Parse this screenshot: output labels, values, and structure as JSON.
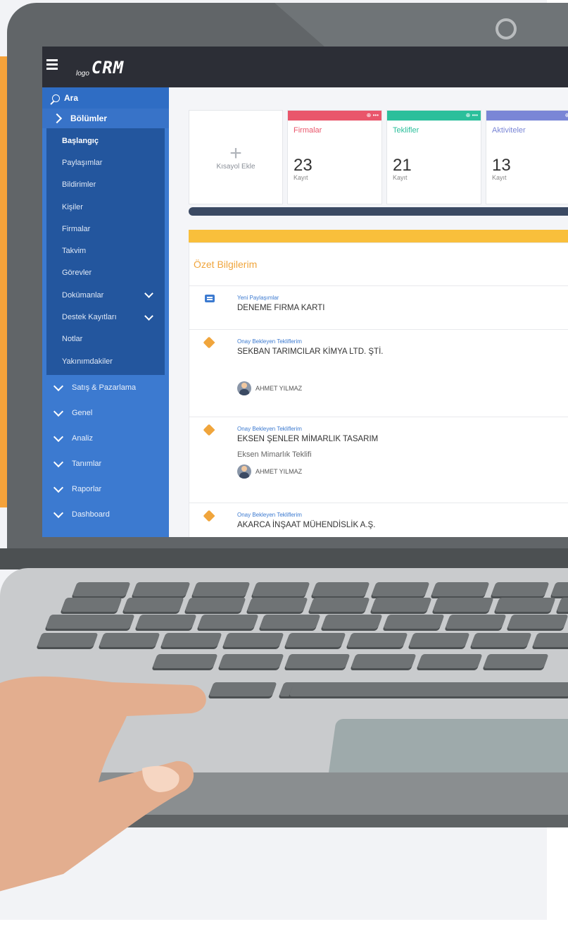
{
  "app": {
    "logo_small": "logo",
    "logo_big": "CRM"
  },
  "sidebar": {
    "search_label": "Ara",
    "section_label": "Bölümler",
    "items": [
      {
        "label": "Başlangıç",
        "active": true,
        "expandable": false
      },
      {
        "label": "Paylaşımlar",
        "active": false,
        "expandable": false
      },
      {
        "label": "Bildirimler",
        "active": false,
        "expandable": false
      },
      {
        "label": "Kişiler",
        "active": false,
        "expandable": false
      },
      {
        "label": "Firmalar",
        "active": false,
        "expandable": false
      },
      {
        "label": "Takvim",
        "active": false,
        "expandable": false
      },
      {
        "label": "Görevler",
        "active": false,
        "expandable": false
      },
      {
        "label": "Dokümanlar",
        "active": false,
        "expandable": true
      },
      {
        "label": "Destek Kayıtları",
        "active": false,
        "expandable": true
      },
      {
        "label": "Notlar",
        "active": false,
        "expandable": false
      },
      {
        "label": "Yakınımdakiler",
        "active": false,
        "expandable": false
      }
    ],
    "groups": [
      {
        "label": "Satış & Pazarlama"
      },
      {
        "label": "Genel"
      },
      {
        "label": "Analiz"
      },
      {
        "label": "Tanımlar"
      },
      {
        "label": "Raporlar"
      },
      {
        "label": "Dashboard"
      }
    ]
  },
  "shortcut": {
    "add_label": "Kısayol Ekle"
  },
  "cards": [
    {
      "title": "Firmalar",
      "count": "23",
      "unit": "Kayıt",
      "color": "#e9566b",
      "dots": "⊕ •••"
    },
    {
      "title": "Teklifler",
      "count": "21",
      "unit": "Kayıt",
      "color": "#2bbf9b",
      "dots": "⊕ •••"
    },
    {
      "title": "Aktiviteler",
      "count": "13",
      "unit": "Kayıt",
      "color": "#7a86d6",
      "dots": "⊕ •••"
    }
  ],
  "summary": {
    "title": "Özet Bilgilerim",
    "items": [
      {
        "icon": "chat-icon",
        "category": "Yeni Paylaşımlar",
        "title": "DENEME FIRMA KARTI",
        "desc": "",
        "user": ""
      },
      {
        "icon": "tag-icon",
        "category": "Onay Bekleyen Tekliflerim",
        "title": "SEKBAN TARIMCILAR KİMYA LTD. ŞTİ.",
        "desc": "",
        "user": "AHMET YILMAZ"
      },
      {
        "icon": "tag-icon",
        "category": "Onay Bekleyen Tekliflerim",
        "title": "EKSEN ŞENLER MİMARLIK TASARIM",
        "desc": "Eksen Mimarlık Teklifi",
        "user": "AHMET YILMAZ"
      },
      {
        "icon": "tag-icon",
        "category": "Onay Bekleyen Tekliflerim",
        "title": "AKARCA İNŞAAT MÜHENDİSLİK A.Ş.",
        "desc": "",
        "user": ""
      }
    ]
  },
  "colors": {
    "topbar": "#2c2e36",
    "sidebar": "#3c7ad0",
    "accent_orange": "#f0a53c",
    "accent_yellow": "#f9bf3b"
  }
}
